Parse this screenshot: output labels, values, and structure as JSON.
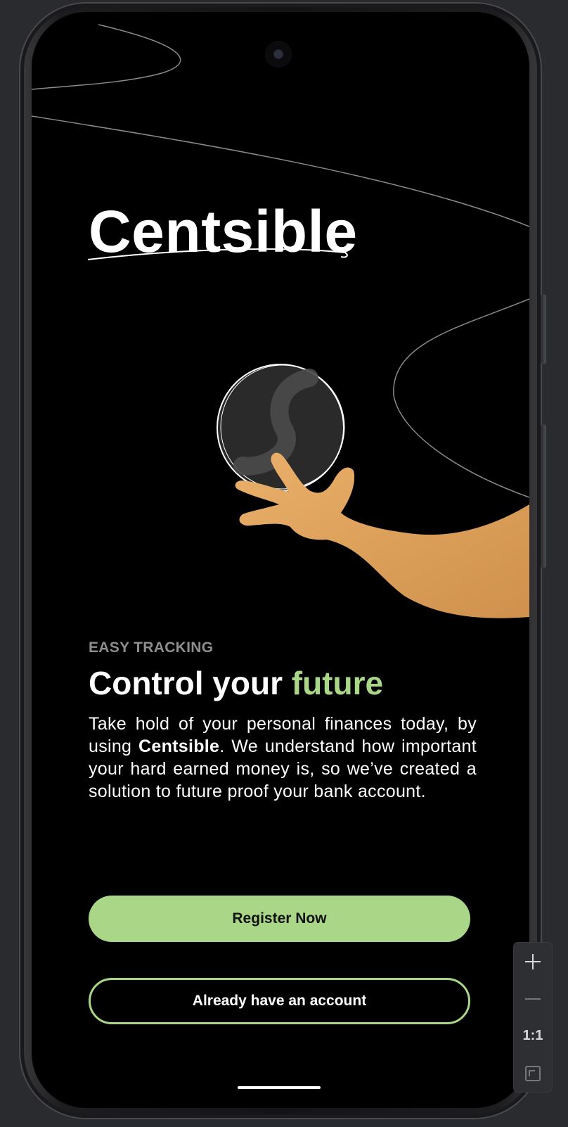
{
  "app": {
    "name": "Centsible"
  },
  "onboarding": {
    "eyebrow": "EASY TRACKING",
    "headline_main": "Control your ",
    "headline_accent": "future",
    "body_part1": "Take hold of your personal finances today, by using ",
    "body_brand": "Centsible",
    "body_part2": ". We understand how important your hard earned money is, so we’ve created a solution to future proof your bank account.",
    "register_label": "Register Now",
    "login_label": "Already have an account"
  },
  "zoom_controls": {
    "zoom_in_icon": "plus-icon",
    "zoom_out_icon": "minus-icon",
    "actual_size_label": "1:1",
    "fit_icon": "fit-screen-icon"
  },
  "colors": {
    "accent": "#a9d787",
    "background": "#000000",
    "hand": "#e3a55f",
    "muted_text": "#8e8e8e"
  }
}
